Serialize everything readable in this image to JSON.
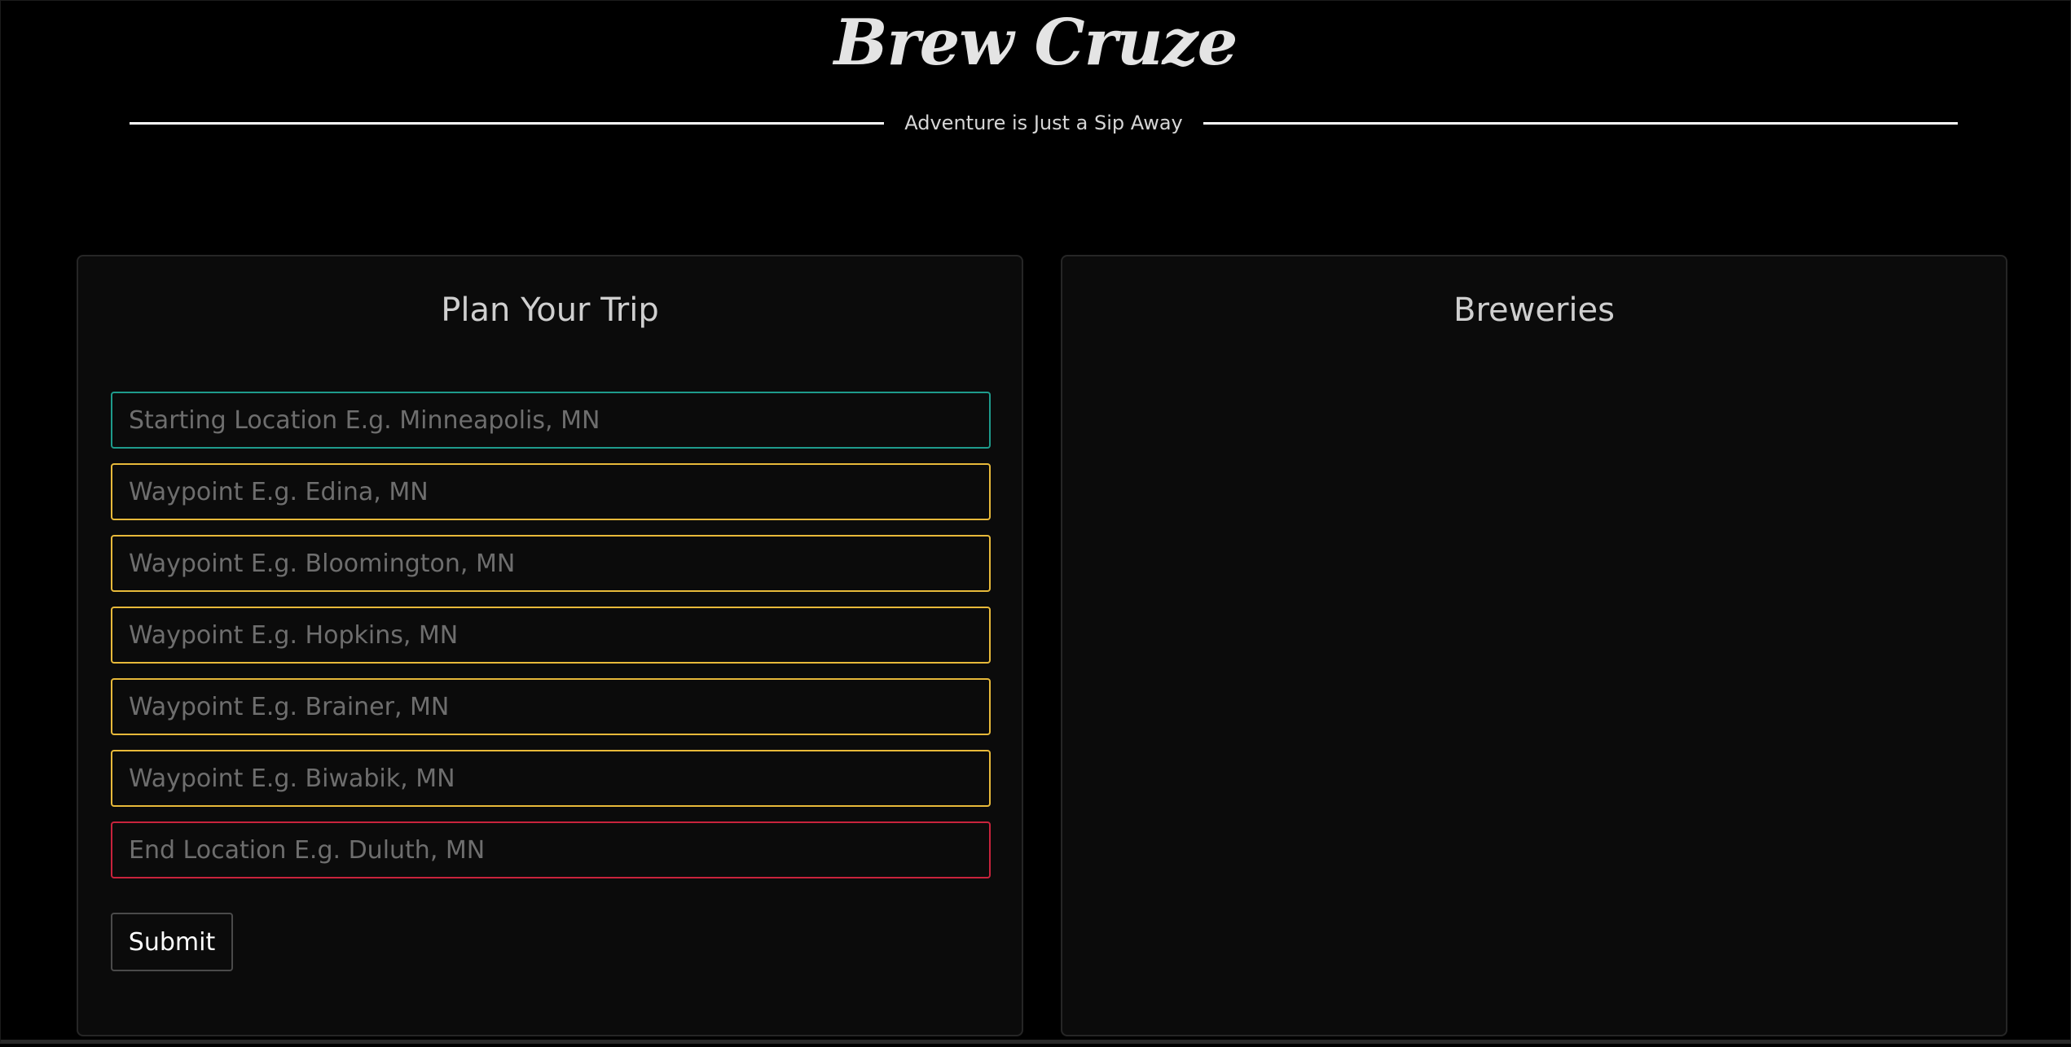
{
  "header": {
    "title": "Brew Cruze",
    "tagline": "Adventure is Just a Sip Away"
  },
  "plan_panel": {
    "title": "Plan Your Trip",
    "start_placeholder": "Starting Location E.g. Minneapolis, MN",
    "waypoints": [
      {
        "placeholder": "Waypoint E.g. Edina, MN"
      },
      {
        "placeholder": "Waypoint E.g. Bloomington, MN"
      },
      {
        "placeholder": "Waypoint E.g. Hopkins, MN"
      },
      {
        "placeholder": "Waypoint E.g. Brainer, MN"
      },
      {
        "placeholder": "Waypoint E.g. Biwabik, MN"
      }
    ],
    "end_placeholder": "End Location E.g. Duluth, MN",
    "submit_label": "Submit"
  },
  "breweries_panel": {
    "title": "Breweries",
    "items": []
  },
  "colors": {
    "background": "#000000",
    "panel": "#0b0b0b",
    "start_border": "#1e9b8c",
    "waypoint_border": "#e7b93a",
    "end_border": "#c8233c"
  }
}
